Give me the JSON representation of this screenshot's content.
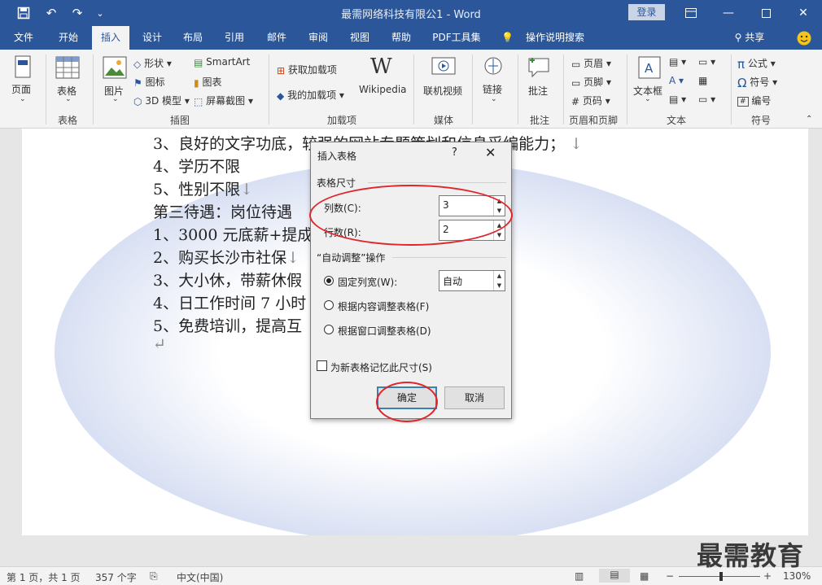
{
  "app": {
    "doc_title": "最需网络科技有限公1  -  Word",
    "login_label": "登录",
    "share_label": "共享"
  },
  "tabs": [
    "文件",
    "开始",
    "插入",
    "设计",
    "布局",
    "引用",
    "邮件",
    "审阅",
    "视图",
    "帮助",
    "PDF工具集",
    "操作说明搜索"
  ],
  "ribbon": {
    "page_label": "页面",
    "table_label": "表格",
    "table_group": "表格",
    "picture_label": "图片",
    "shapes_label": "形状",
    "icons_label": "图标",
    "model3d_label": "3D 模型",
    "smartart_label": "SmartArt",
    "chart_label": "图表",
    "screenshot_label": "屏幕截图",
    "illustrations_group": "插图",
    "get_addins_label": "获取加载项",
    "my_addins_label": "我的加载项",
    "wikipedia_label": "Wikipedia",
    "addins_group": "加载项",
    "online_video_label": "联机视频",
    "media_group": "媒体",
    "link_label": "链接",
    "comment_label": "批注",
    "comment_group": "批注",
    "header_label": "页眉",
    "footer_label": "页脚",
    "page_number_label": "页码",
    "header_footer_group": "页眉和页脚",
    "textbox_label": "文本框",
    "text_group": "文本",
    "equation_label": "公式",
    "symbol_label": "符号",
    "number_label": "编号",
    "symbols_group": "符号"
  },
  "document": {
    "lines": [
      "3、良好的文字功底，较强的网站专题策划和信息采编能力；",
      "4、学历不限",
      "5、性别不限",
      "第三待遇：岗位待遇",
      "1、3000 元底薪+提成",
      "2、购买长沙市社保",
      "3、大小休，带薪休假",
      "4、日工作时间 7 小时",
      "5、免费培训，提高互"
    ]
  },
  "dialog": {
    "title": "插入表格",
    "help": "?",
    "close": "✕",
    "size_section": "表格尺寸",
    "columns_label": "列数(C):",
    "columns_value": "3",
    "rows_label": "行数(R):",
    "rows_value": "2",
    "autofit_section": "“自动调整”操作",
    "fixed_width_label": "固定列宽(W):",
    "fixed_width_value": "自动",
    "autofit_content_label": "根据内容调整表格(F)",
    "autofit_window_label": "根据窗口调整表格(D)",
    "remember_label": "为新表格记忆此尺寸(S)",
    "ok_label": "确定",
    "cancel_label": "取消"
  },
  "status": {
    "page": "第 1 页，共 1 页",
    "words": "357 个字",
    "language": "中文(中国)",
    "zoom": "130%"
  },
  "watermark": "最需教育",
  "colors": {
    "accent": "#2b579a",
    "annotation": "#e0262b"
  }
}
